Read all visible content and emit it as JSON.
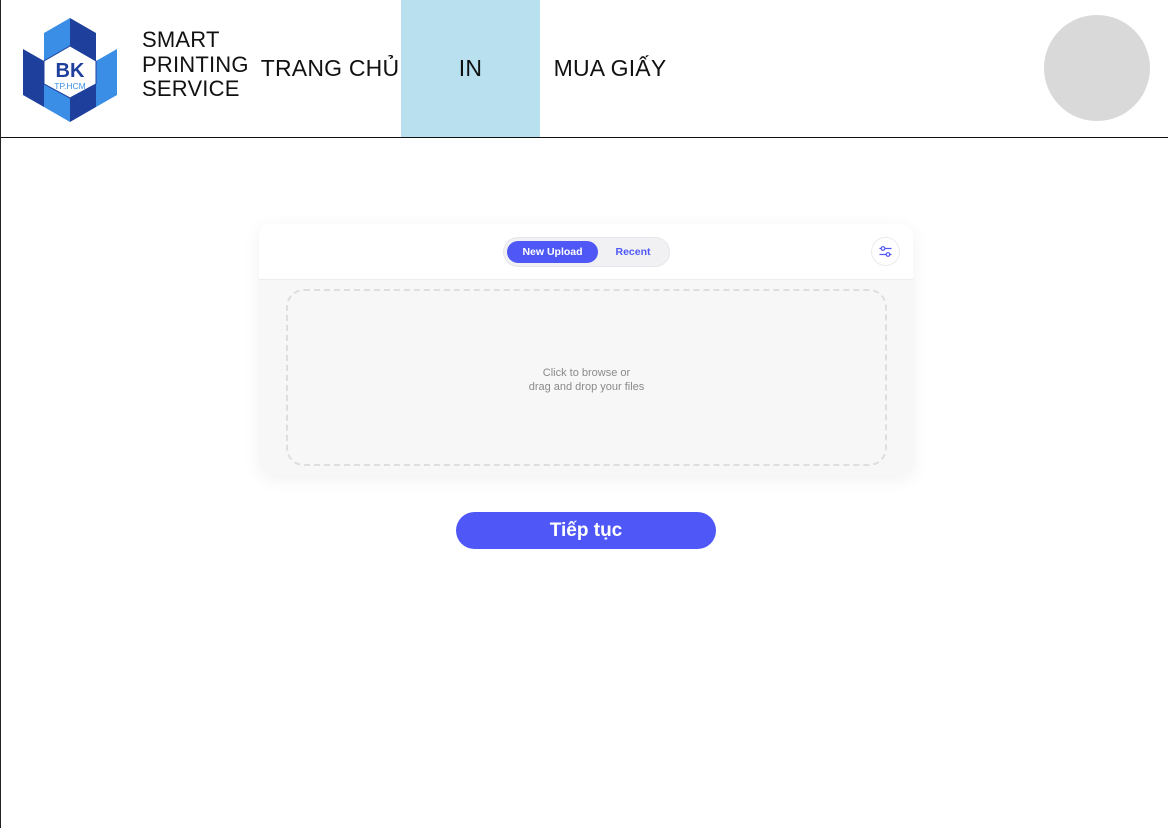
{
  "brand": {
    "logo_text": "BK",
    "logo_subtext": "TP.HCM",
    "line1": "SMART",
    "line2": "PRINTING",
    "line3": "SERVICE"
  },
  "nav": {
    "home": "TRANG CHỦ",
    "print": "IN",
    "buy_paper": "MUA GIẤY",
    "active": "IN"
  },
  "upload": {
    "tabs": {
      "new_upload": "New Upload",
      "recent": "Recent",
      "active": "New Upload"
    },
    "drop_line1": "Click to browse or",
    "drop_line2": "drag and drop your files"
  },
  "actions": {
    "continue": "Tiếp tục"
  },
  "colors": {
    "accent": "#4f58f7",
    "nav_active_bg": "#b8e0ef",
    "avatar": "#d9d9d9",
    "logo_dark": "#1e3f9c",
    "logo_light": "#3a8ee6"
  },
  "icons": {
    "filter": "sliders-icon"
  }
}
